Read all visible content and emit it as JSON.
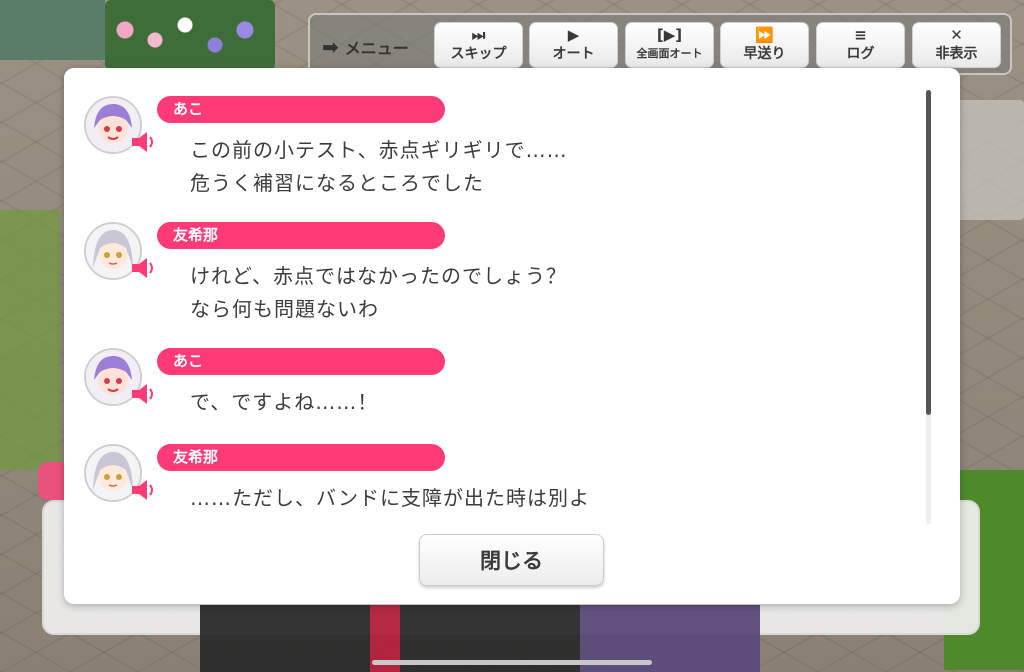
{
  "toolbar": {
    "menu_label": "メニュー",
    "buttons": [
      {
        "icon": "skip-icon",
        "glyph": "⏭",
        "label": "スキップ"
      },
      {
        "icon": "play-icon",
        "glyph": "▶",
        "label": "オート"
      },
      {
        "icon": "fullscreen-auto-icon",
        "glyph": "[▶]",
        "label": "全画面オート"
      },
      {
        "icon": "fast-forward-icon",
        "glyph": "⏩",
        "label": "早送り"
      },
      {
        "icon": "log-icon",
        "glyph": "≡",
        "label": "ログ"
      },
      {
        "icon": "close-x-icon",
        "glyph": "✕",
        "label": "非表示"
      }
    ]
  },
  "log": {
    "entries": [
      {
        "speaker": "あこ",
        "lines": [
          "この前の小テスト、赤点ギリギリで……",
          "危うく補習になるところでした"
        ],
        "avatar": "ako"
      },
      {
        "speaker": "友希那",
        "lines": [
          "けれど、赤点ではなかったのでしょう？",
          "なら何も問題ないわ"
        ],
        "avatar": "yukina"
      },
      {
        "speaker": "あこ",
        "lines": [
          "で、ですよね……！"
        ],
        "avatar": "ako"
      },
      {
        "speaker": "友希那",
        "lines": [
          "……ただし、バンドに支障が出た時は別よ"
        ],
        "avatar": "yukina"
      }
    ],
    "close_label": "閉じる"
  },
  "colors": {
    "name_bar": "#ff3b77",
    "speaker_icon": "#ff3b77",
    "ako_hair": "#9b7fd6",
    "yukina_hair": "#c9c7d6"
  }
}
